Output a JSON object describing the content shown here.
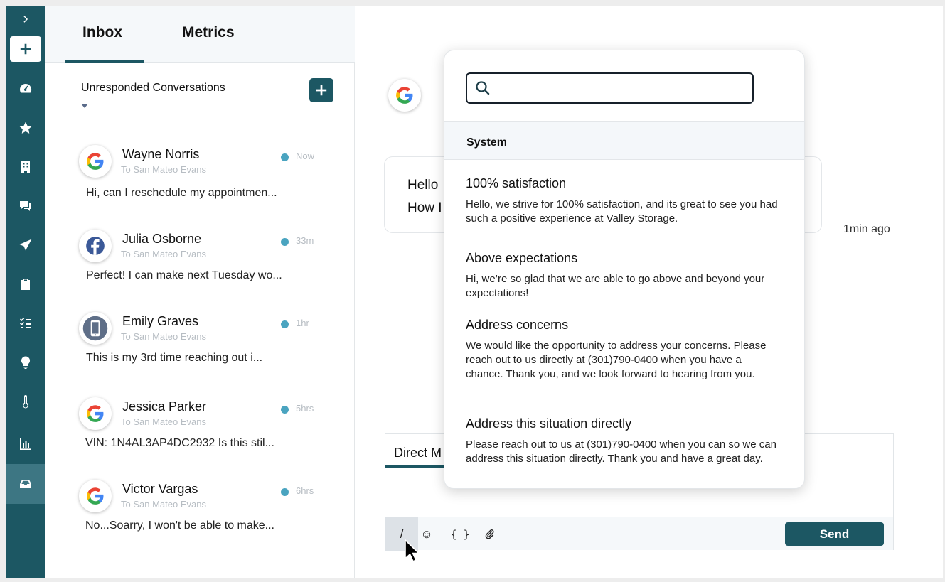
{
  "tabs": [
    "Inbox",
    "Metrics"
  ],
  "filter": {
    "label": "Unresponded Conversations"
  },
  "conversations": [
    {
      "name": "Wayne Norris",
      "to": "To San Mateo Evans",
      "time": "Now",
      "preview": "Hi, can I reschedule my appointmen...",
      "source": "google-icon"
    },
    {
      "name": "Julia Osborne",
      "to": "To San Mateo Evans",
      "time": "33m",
      "preview": "Perfect! I can make next Tuesday wo...",
      "source": "facebook-icon"
    },
    {
      "name": "Emily Graves",
      "to": "To San Mateo Evans",
      "time": "1hr",
      "preview": "This is my 3rd time reaching out i...",
      "source": "phone-icon"
    },
    {
      "name": "Jessica Parker",
      "to": "To San Mateo Evans",
      "time": "5hrs",
      "preview": "VIN: 1N4AL3AP4DC2932 Is this stil...",
      "source": "google-icon"
    },
    {
      "name": "Victor Vargas",
      "to": "To San Mateo Evans",
      "time": "6hrs",
      "preview": "No...Soarry, I won't be able to make...",
      "source": "google-icon"
    }
  ],
  "chat": {
    "message_lines": [
      "Hello",
      "How I"
    ],
    "message_time": "1min ago",
    "composer_tab": "Direct M",
    "toolbar": {
      "slash": "/",
      "emoji": "☺",
      "braces": "{ }",
      "attach": "📎"
    },
    "send_label": "Send"
  },
  "templates": {
    "search_value": "",
    "section": "System",
    "items": [
      {
        "title": "100% satisfaction",
        "body": "Hello, we strive for 100% satisfaction, and its great to see you had such a positive experience at Valley Storage."
      },
      {
        "title": "Above expectations",
        "body": "Hi, we’re so glad that we are able to go above and beyond your expectations!"
      },
      {
        "title": "Address concerns",
        "body": "We would like the opportunity to address your concerns. Please reach out to us directly at (301)790-0400 when you have a chance. Thank you, and we look forward to hearing from you."
      },
      {
        "title": "Address this situation directly",
        "body": "Please reach out to us at (301)790-0400 when you can so we can address this situation directly. Thank you and have a great day."
      }
    ]
  },
  "sidebar": {
    "items": [
      "chevron-right-icon",
      "compose-icon",
      "dashboard-icon",
      "star-icon",
      "building-icon",
      "chat-icon",
      "send-icon",
      "clipboard-icon",
      "checklist-icon",
      "lightbulb-icon",
      "thermometer-icon",
      "bar-chart-icon",
      "inbox-icon"
    ]
  },
  "colors": {
    "brand": "#1c5763",
    "accent_dot": "#4aa4c0"
  }
}
